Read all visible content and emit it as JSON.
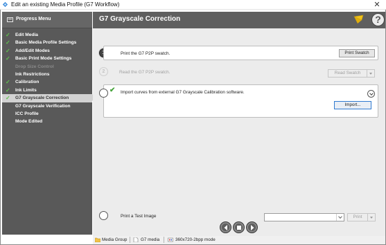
{
  "window": {
    "title": "Edit an existing Media Profile (G7 Workflow)",
    "close_glyph": "✕"
  },
  "sidebar": {
    "title": "Progress Menu",
    "items": [
      {
        "label": "Edit Media",
        "state": "done"
      },
      {
        "label": "Basic Media Profile Settings",
        "state": "done"
      },
      {
        "label": "Add/Edit Modes",
        "state": "done"
      },
      {
        "label": "Basic Print Mode Settings",
        "state": "done"
      },
      {
        "label": "Drop Size Control",
        "state": "disabled"
      },
      {
        "label": "Ink Restrictions",
        "state": "plain"
      },
      {
        "label": "Calibration",
        "state": "done"
      },
      {
        "label": "Ink Limits",
        "state": "done"
      },
      {
        "label": "G7 Grayscale Correction",
        "state": "active"
      },
      {
        "label": "G7 Grayscale Verification",
        "state": "plain"
      },
      {
        "label": "ICC Profile",
        "state": "plain"
      },
      {
        "label": "Mode Edited",
        "state": "plain"
      }
    ]
  },
  "header": {
    "title": "G7 Grayscale Correction",
    "help_glyph": "?"
  },
  "steps": {
    "step1": {
      "number": "1",
      "text": "Print the G7 P2P swatch.",
      "button": "Print Swatch"
    },
    "step2": {
      "number": "2",
      "text": "Read the G7 P2P swatch.",
      "button": "Read Swatch"
    },
    "step3": {
      "text": "Import curves from external G7 Grayscale Calibration software.",
      "button": "Import..."
    },
    "step4": {
      "text": "Print a Test Image",
      "dropdown_value": "",
      "button": "Print"
    }
  },
  "footer": {
    "media_group": "Media Group",
    "media": "G7 media",
    "mode": "360x720-2bpp mode"
  },
  "icons": {
    "check": "✓",
    "check_heavy": "✔"
  },
  "colors": {
    "accent_check": "#5fc34c",
    "header_bg": "#5f5f5f",
    "sidebar_bg": "#595959"
  }
}
